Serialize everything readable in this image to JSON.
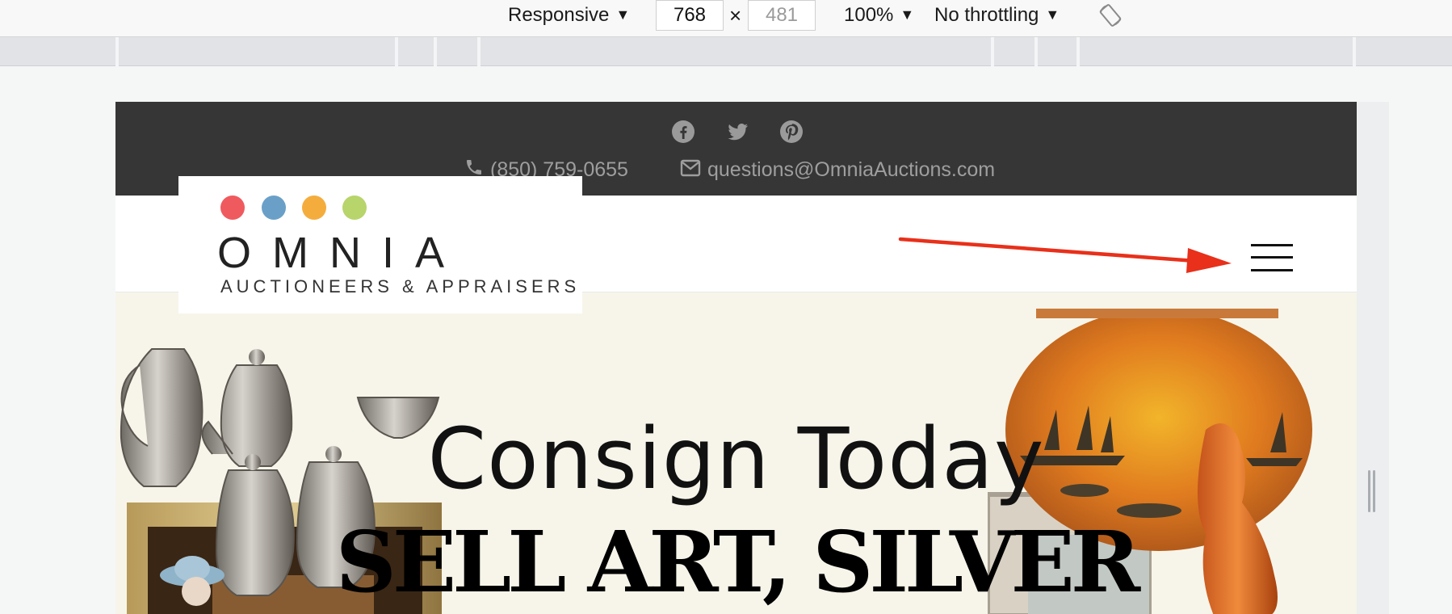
{
  "devtools": {
    "device_mode": "Responsive",
    "width": "768",
    "times": "×",
    "height": "481",
    "zoom": "100%",
    "throttling": "No throttling"
  },
  "site": {
    "social": [
      "facebook-icon",
      "twitter-icon",
      "pinterest-icon"
    ],
    "phone": "(850) 759-0655",
    "email": "questions@OmniaAuctions.com",
    "logo": {
      "name": "OMNIA",
      "tagline": "AUCTIONEERS & APPRAISERS",
      "dot_colors": [
        "#ef5a5f",
        "#6aa0c8",
        "#f4ad3d",
        "#b7d56a"
      ]
    },
    "hero": {
      "line1": "Consign Today",
      "line2": "SELL ART, SILVER"
    }
  },
  "colors": {
    "topbar": "#363636",
    "annotation_arrow": "#e8301a"
  }
}
